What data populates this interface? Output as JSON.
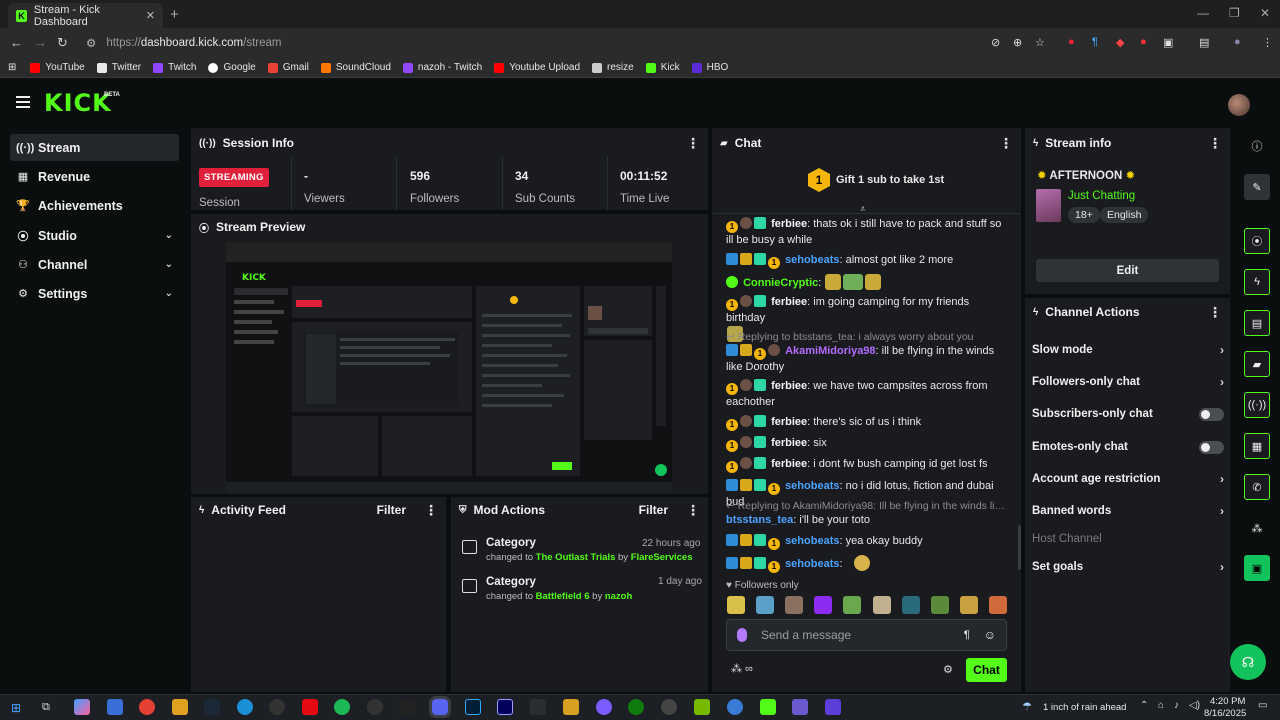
{
  "browser": {
    "tab_title": "Stream - Kick Dashboard",
    "url_scheme": "https://",
    "url_host": "dashboard.kick.com",
    "url_path": "/stream",
    "bookmarks": [
      {
        "label": "YouTube",
        "color": "#ff0000"
      },
      {
        "label": "Twitter",
        "color": "#e7e7e7"
      },
      {
        "label": "Twitch",
        "color": "#9146ff"
      },
      {
        "label": "Google",
        "color": "#ffffff"
      },
      {
        "label": "Gmail",
        "color": "#ea4335"
      },
      {
        "label": "SoundCloud",
        "color": "#ff7700"
      },
      {
        "label": "nazoh - Twitch",
        "color": "#9146ff"
      },
      {
        "label": "Youtube Upload",
        "color": "#ff0000"
      },
      {
        "label": "resize",
        "color": "#cccccc"
      },
      {
        "label": "Kick",
        "color": "#53fc18"
      },
      {
        "label": "HBO",
        "color": "#5b2bd8"
      }
    ]
  },
  "app": {
    "logo": "KICK",
    "logo_badge": "BETA",
    "accent": "#53fc18"
  },
  "sidebar": {
    "items": [
      {
        "label": "Stream",
        "icon": "broadcast-icon"
      },
      {
        "label": "Revenue",
        "icon": "chart-icon"
      },
      {
        "label": "Achievements",
        "icon": "trophy-icon"
      },
      {
        "label": "Studio",
        "icon": "studio-icon"
      },
      {
        "label": "Channel",
        "icon": "channel-icon"
      },
      {
        "label": "Settings",
        "icon": "gear-icon"
      }
    ]
  },
  "session": {
    "title": "Session Info",
    "status": "STREAMING",
    "status_label": "Session",
    "viewers_value": "-",
    "viewers_label": "Viewers",
    "followers_value": "596",
    "followers_label": "Followers",
    "subs_value": "34",
    "subs_label": "Sub Counts",
    "time_value": "00:11:52",
    "time_label": "Time Live"
  },
  "preview": {
    "title": "Stream Preview"
  },
  "activity": {
    "title": "Activity Feed",
    "filter": "Filter"
  },
  "mod": {
    "title": "Mod Actions",
    "filter": "Filter",
    "items": [
      {
        "title": "Category",
        "prefix": "changed to",
        "target": "The Outlast Trials",
        "by": "by",
        "user": "FlareServices",
        "time": "22 hours ago"
      },
      {
        "title": "Category",
        "prefix": "changed to",
        "target": "Battlefield 6",
        "by": "by",
        "user": "nazoh",
        "time": "1 day ago"
      }
    ]
  },
  "chat": {
    "title": "Chat",
    "gift_count": "1",
    "gift_text": "Gift 1 sub to take 1st",
    "messages": [
      {
        "user": "ferbiee",
        "text": ": thats ok i still have to pack and stuff so ill be busy a while"
      },
      {
        "user": "sehobeats",
        "text": ": almost got like 2 more"
      },
      {
        "user": "ConnieCryptic",
        "text": ":"
      },
      {
        "user": "ferbiee",
        "text": ": im going camping for my friends birthday"
      },
      {
        "user": "AkamiMidoriya98",
        "text": ": ill be flying in the winds like Dorothy"
      },
      {
        "user": "ferbiee",
        "text": ": we have two campsites across from eachother"
      },
      {
        "user": "ferbiee",
        "text": ": there's sic of us i think"
      },
      {
        "user": "ferbiee",
        "text": ": six"
      },
      {
        "user": "ferbiee",
        "text": ": i dont fw bush camping id get lost fs"
      },
      {
        "user": "sehobeats",
        "text": ": no i did lotus, fiction and dubai bud"
      },
      {
        "user": "btsstans_tea",
        "text": ": i'll be your toto"
      },
      {
        "user": "sehobeats",
        "text": ": yea okay buddy"
      },
      {
        "user": "sehobeats",
        "text": ":"
      }
    ],
    "reply1": "Replying to btsstans_tea: i always worry about you",
    "reply2": "Replying to AkamiMidoriya98: Ill be flying in the winds like Do...",
    "followers_only": "Followers only",
    "input_placeholder": "Send a message",
    "send_label": "Chat"
  },
  "stream_info": {
    "title": "Stream info",
    "stream_title": "AFTERNOON",
    "category": "Just Chatting",
    "tags": [
      "18+",
      "English"
    ],
    "edit_label": "Edit"
  },
  "channel_actions": {
    "title": "Channel Actions",
    "items": [
      {
        "label": "Slow mode",
        "kind": "chevron"
      },
      {
        "label": "Followers-only chat",
        "kind": "chevron"
      },
      {
        "label": "Subscribers-only chat",
        "kind": "toggle"
      },
      {
        "label": "Emotes-only chat",
        "kind": "toggle"
      },
      {
        "label": "Account age restriction",
        "kind": "chevron"
      },
      {
        "label": "Banned words",
        "kind": "chevron"
      },
      {
        "label": "Host Channel",
        "kind": "disabled"
      },
      {
        "label": "Set goals",
        "kind": "chevron"
      }
    ]
  },
  "taskbar": {
    "weather": "1 inch of rain ahead",
    "time": "4:20 PM",
    "date": "8/16/2025"
  }
}
